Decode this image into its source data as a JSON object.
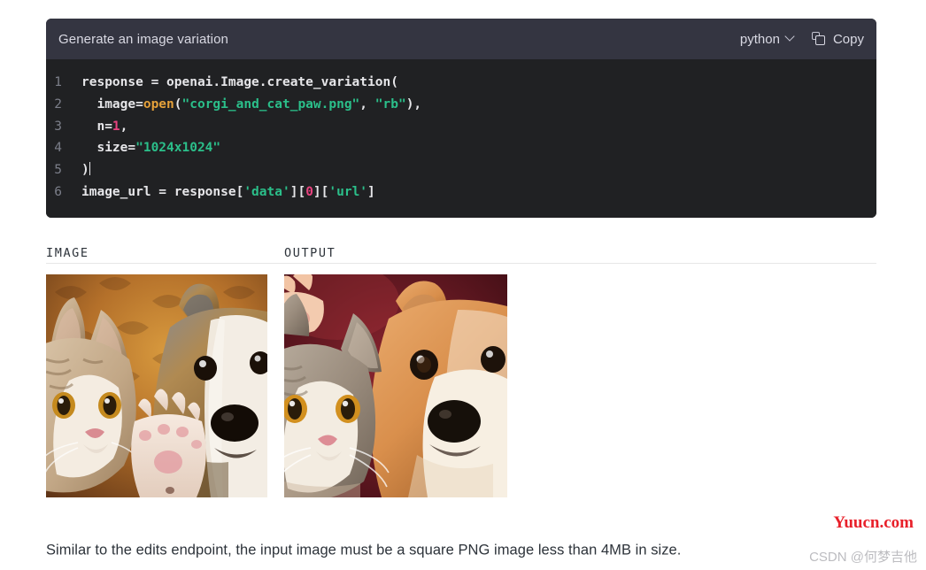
{
  "code_card": {
    "title": "Generate an image variation",
    "language": "python",
    "language_chevron_icon": "chevron-down-icon",
    "copy_label": "Copy",
    "copy_icon": "copy-icon",
    "theme": {
      "header_bg": "#343541",
      "body_bg": "#202123",
      "text": "#e6e6e9",
      "line_number": "#7c7f8a",
      "string": "#2bbf8a",
      "function": "#e5a13a",
      "number": "#e8437f"
    },
    "lines": [
      {
        "n": "1",
        "text": "response = openai.Image.create_variation("
      },
      {
        "n": "2",
        "text": "  image=open(\"corgi_and_cat_paw.png\", \"rb\"),"
      },
      {
        "n": "3",
        "text": "  n=1,"
      },
      {
        "n": "4",
        "text": "  size=\"1024x1024\""
      },
      {
        "n": "5",
        "text": ")"
      },
      {
        "n": "6",
        "text": "image_url = response['data'][0]['url']"
      }
    ]
  },
  "columns": {
    "image_label": "IMAGE",
    "output_label": "OUTPUT",
    "input_image_alt": "Photo of a tabby cat raising its paw next to a corgi dog, warm orange background",
    "output_image_alt": "AI generated variation: tabby cat and corgi dog on a deep red background"
  },
  "caption": "Similar to the edits endpoint, the input image must be a square PNG image less than 4MB in size.",
  "watermarks": {
    "primary": "Yuucn.com",
    "primary_color": "#e8202a",
    "secondary": "CSDN @何梦吉他"
  }
}
